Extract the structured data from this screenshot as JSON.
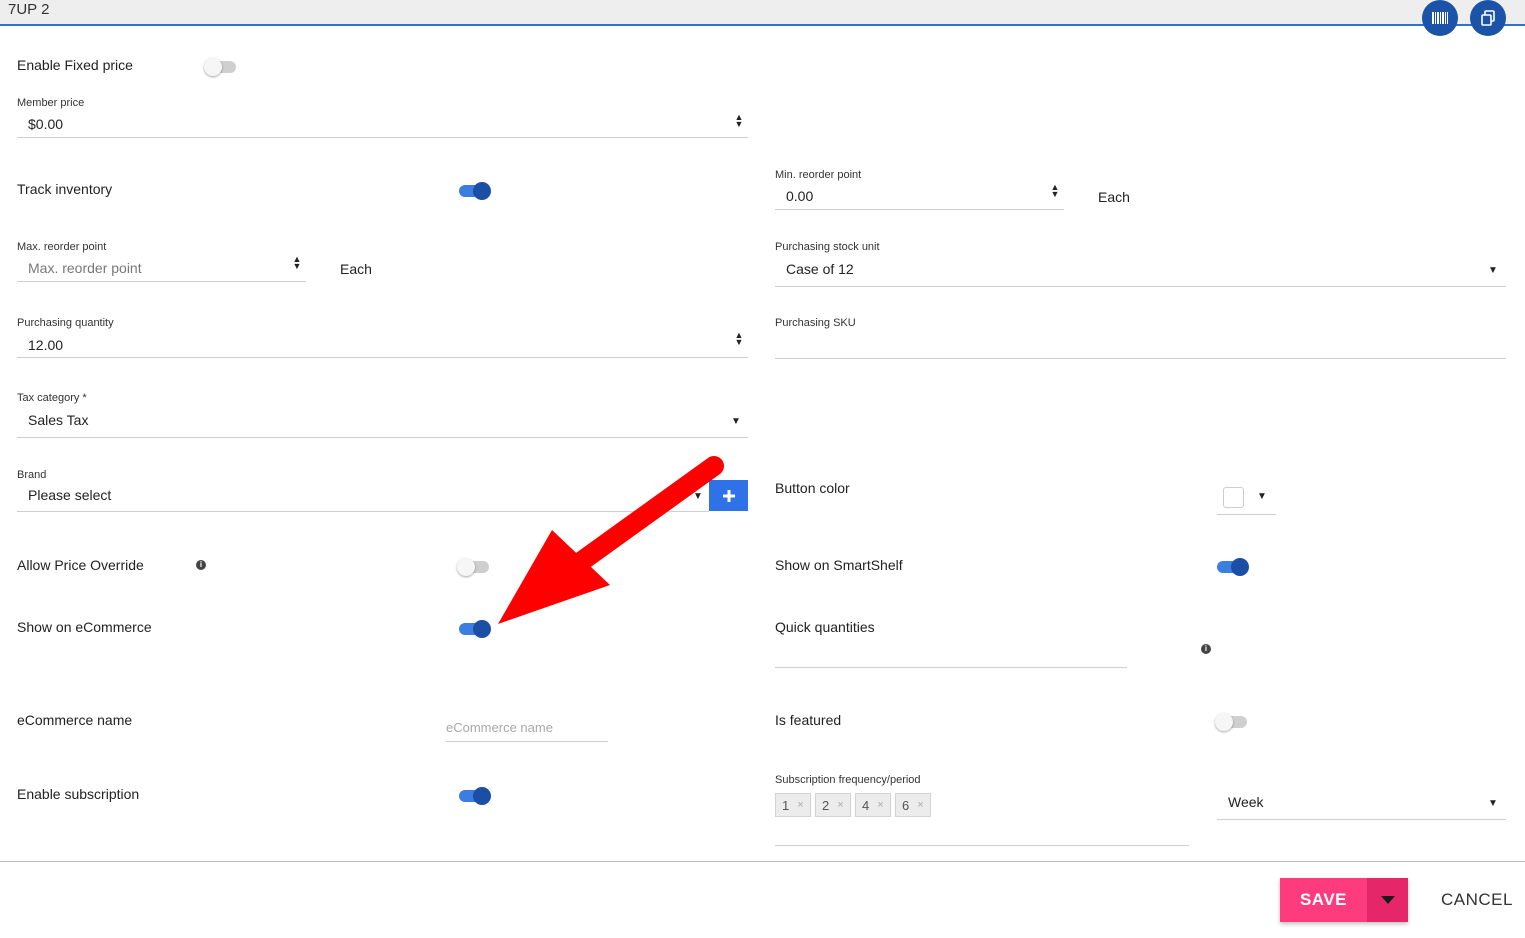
{
  "window": {
    "title": "7UP 2",
    "barcode_icon": "barcode-icon",
    "duplicate_icon": "copy-icon"
  },
  "fixed_price": {
    "label": "Enable Fixed price",
    "enabled": false
  },
  "member_price": {
    "label": "Member price",
    "value": "$0.00"
  },
  "track_inventory": {
    "label": "Track inventory",
    "enabled": true
  },
  "min_reorder": {
    "label": "Min. reorder point",
    "value": "0.00",
    "unit": "Each"
  },
  "max_reorder": {
    "label": "Max. reorder point",
    "placeholder": "Max. reorder point",
    "unit": "Each"
  },
  "purchasing_stock_unit": {
    "label": "Purchasing stock unit",
    "value": "Case of 12"
  },
  "purchasing_quantity": {
    "label": "Purchasing quantity",
    "value": "12.00"
  },
  "purchasing_sku": {
    "label": "Purchasing SKU",
    "value": ""
  },
  "tax_category": {
    "label": "Tax category *",
    "value": "Sales Tax"
  },
  "brand": {
    "label": "Brand",
    "value": "Please select",
    "add_icon": "plus-icon"
  },
  "button_color": {
    "label": "Button color",
    "swatch": "#ffffff"
  },
  "allow_price_override": {
    "label": "Allow Price Override",
    "enabled": false,
    "info_icon": "info-icon"
  },
  "show_on_smartshelf": {
    "label": "Show on SmartShelf",
    "enabled": true
  },
  "show_on_ecommerce": {
    "label": "Show on eCommerce",
    "enabled": true
  },
  "quick_quantities": {
    "label": "Quick quantities",
    "value": "",
    "info_icon": "info-icon"
  },
  "ecommerce_name": {
    "label": "eCommerce name",
    "placeholder": "eCommerce name"
  },
  "is_featured": {
    "label": "Is featured",
    "enabled": false
  },
  "subscription": {
    "label": "Enable subscription",
    "enabled": true,
    "frequency_label": "Subscription frequency/period",
    "frequencies": [
      "1",
      "2",
      "4",
      "6"
    ],
    "chip_remove": "×",
    "period": "Week"
  },
  "footer": {
    "save_label": "SAVE",
    "cancel_label": "CANCEL"
  },
  "annotation": {
    "arrow_color": "#ff0000",
    "points_to": "Show on eCommerce toggle"
  },
  "colors": {
    "accent": "#1b53a8",
    "toggle_on": "#3c7de0",
    "save": "#fd3b7d",
    "add_button": "#2f72e8"
  }
}
